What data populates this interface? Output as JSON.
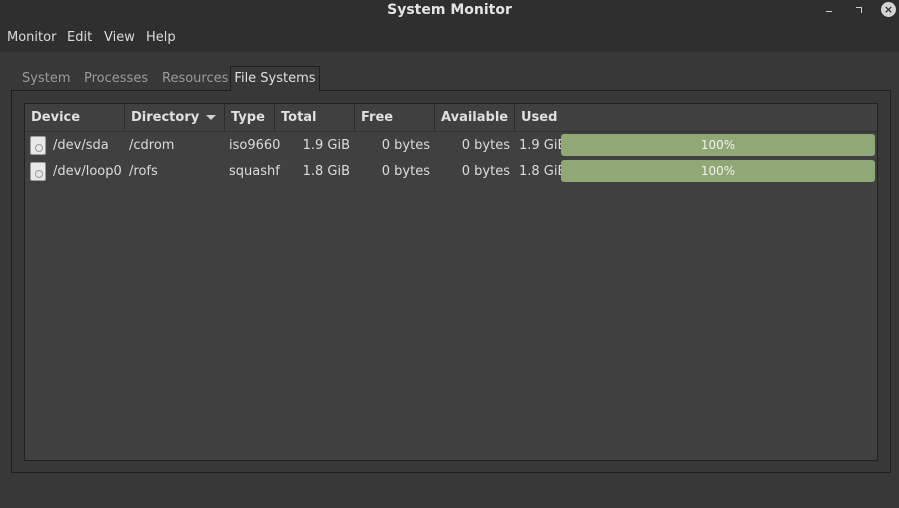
{
  "window": {
    "title": "System Monitor"
  },
  "menu": [
    "Monitor",
    "Edit",
    "View",
    "Help"
  ],
  "tabs": [
    "System",
    "Processes",
    "Resources",
    "File Systems"
  ],
  "active_tab": "File Systems",
  "columns": {
    "device": "Device",
    "directory": "Directory",
    "type": "Type",
    "total": "Total",
    "free": "Free",
    "available": "Available",
    "used": "Used"
  },
  "sort_column": "Directory",
  "rows": [
    {
      "device": "/dev/sda",
      "directory": "/cdrom",
      "type": "iso9660",
      "total": "1.9 GiB",
      "free": "0 bytes",
      "available": "0 bytes",
      "used": "1.9 GiB",
      "percent_label": "100%",
      "percent": 100
    },
    {
      "device": "/dev/loop0",
      "directory": "/rofs",
      "type": "squashf",
      "total": "1.8 GiB",
      "free": "0 bytes",
      "available": "0 bytes",
      "used": "1.8 GiB",
      "percent_label": "100%",
      "percent": 100
    }
  ],
  "icons": {
    "device": "disk-drive-icon"
  },
  "colors": {
    "usage_bar": "#8fa876",
    "background": "#383838"
  }
}
